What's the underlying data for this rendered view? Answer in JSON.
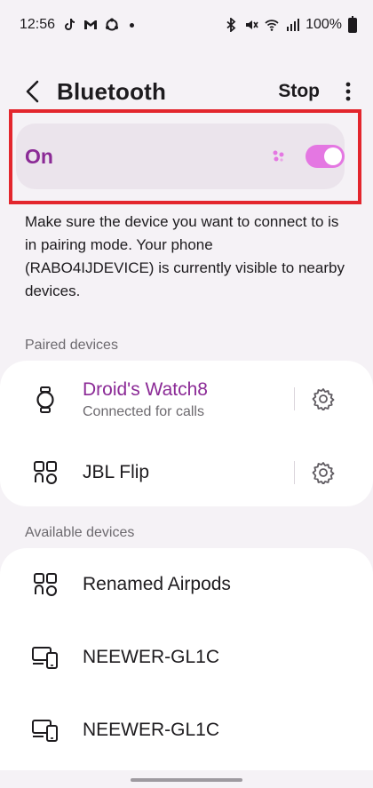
{
  "status_bar": {
    "time": "12:56",
    "battery": "100%",
    "left_icons": [
      "tiktok-icon",
      "gmail-icon",
      "sync-icon",
      "dot-icon"
    ],
    "right_icons": [
      "bluetooth-icon",
      "mute-icon",
      "wifi-icon",
      "signal-icon",
      "battery-icon"
    ]
  },
  "app_bar": {
    "title": "Bluetooth",
    "stop_label": "Stop"
  },
  "toggle": {
    "label": "On",
    "state": "on"
  },
  "description": "Make sure the device you want to connect to is in pairing mode. Your phone (RABO4IJDEVICE) is currently visible to nearby devices.",
  "paired_devices": {
    "header": "Paired devices",
    "items": [
      {
        "name": "Droid's Watch8",
        "status": "Connected for calls",
        "icon": "watch-icon"
      },
      {
        "name": "JBL Flip",
        "status": "",
        "icon": "device-grid-icon"
      }
    ]
  },
  "available_devices": {
    "header": "Available devices",
    "items": [
      {
        "name": "Renamed Airpods",
        "icon": "device-grid-icon"
      },
      {
        "name": "NEEWER-GL1C",
        "icon": "computer-phone-icon"
      },
      {
        "name": "NEEWER-GL1C",
        "icon": "computer-phone-icon"
      }
    ]
  },
  "colors": {
    "accent": "#8b2a96",
    "switch_track": "#e477e2",
    "highlight": "#e3262d",
    "background": "#f5f2f6"
  }
}
